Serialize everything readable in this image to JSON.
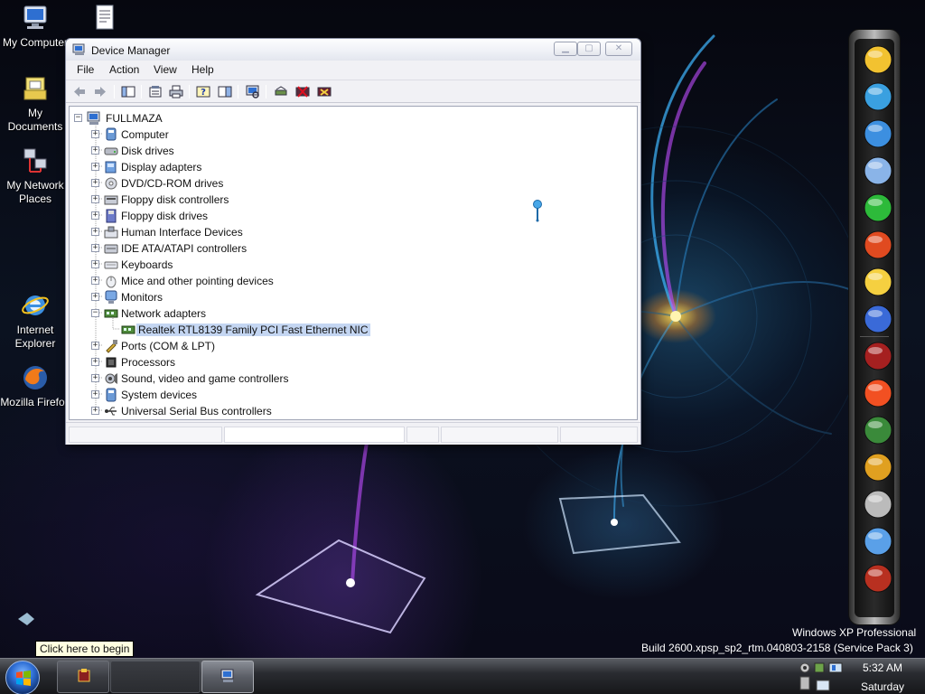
{
  "desktop": {
    "icons": [
      {
        "label": "My Computer"
      },
      {
        "label": "My Documents"
      },
      {
        "label": "My Network Places"
      },
      {
        "label": "Internet Explorer"
      },
      {
        "label": "Mozilla Firefox"
      }
    ],
    "os_name": "Windows XP Professional",
    "os_build": "Build 2600.xpsp_sp2_rtm.040803-2158 (Service Pack 3)",
    "tooltip": "Click here to begin"
  },
  "window": {
    "title": "Device Manager",
    "menu": [
      "File",
      "Action",
      "View",
      "Help"
    ],
    "toolbar_icons": [
      "back-icon",
      "forward-icon",
      "console-tree-icon",
      "properties-icon",
      "print-icon",
      "help-icon",
      "show-hide-icon",
      "scan-hardware-icon",
      "update-driver-icon",
      "disable-device-icon",
      "uninstall-device-icon"
    ],
    "tree": {
      "root": "FULLMAZA",
      "categories": [
        {
          "label": "Computer",
          "icon": "computer-icon",
          "expanded": false
        },
        {
          "label": "Disk drives",
          "icon": "disk-drive-icon",
          "expanded": false
        },
        {
          "label": "Display adapters",
          "icon": "display-adapter-icon",
          "expanded": false
        },
        {
          "label": "DVD/CD-ROM drives",
          "icon": "cd-drive-icon",
          "expanded": false
        },
        {
          "label": "Floppy disk controllers",
          "icon": "floppy-controller-icon",
          "expanded": false
        },
        {
          "label": "Floppy disk drives",
          "icon": "floppy-drive-icon",
          "expanded": false
        },
        {
          "label": "Human Interface Devices",
          "icon": "hid-icon",
          "expanded": false
        },
        {
          "label": "IDE ATA/ATAPI controllers",
          "icon": "ide-controller-icon",
          "expanded": false
        },
        {
          "label": "Keyboards",
          "icon": "keyboard-icon",
          "expanded": false
        },
        {
          "label": "Mice and other pointing devices",
          "icon": "mouse-icon",
          "expanded": false
        },
        {
          "label": "Monitors",
          "icon": "monitor-icon",
          "expanded": false
        },
        {
          "label": "Network adapters",
          "icon": "network-adapter-icon",
          "expanded": true,
          "children": [
            {
              "label": "Realtek RTL8139 Family PCI Fast Ethernet NIC",
              "icon": "network-card-icon",
              "selected": true
            }
          ]
        },
        {
          "label": "Ports (COM & LPT)",
          "icon": "port-icon",
          "expanded": false
        },
        {
          "label": "Processors",
          "icon": "processor-icon",
          "expanded": false
        },
        {
          "label": "Sound, video and game controllers",
          "icon": "sound-icon",
          "expanded": false
        },
        {
          "label": "System devices",
          "icon": "system-device-icon",
          "expanded": false
        },
        {
          "label": "Universal Serial Bus controllers",
          "icon": "usb-icon",
          "expanded": false
        }
      ]
    }
  },
  "dock": {
    "items": [
      "winamp-icon",
      "monitor-icon",
      "internet-explorer-icon",
      "media-player-icon",
      "green-e-icon",
      "media-player-classic-icon",
      "messenger-smiley-icon",
      "msn-messenger-icon",
      "video-clip-icon",
      "windows-flag-icon",
      "books-stack-icon",
      "paint-brushes-icon",
      "printer-icon",
      "network-tools-icon",
      "monster-icon"
    ]
  },
  "taskbar": {
    "time": "5:32 AM",
    "day": "Saturday",
    "buttons": [
      "winrar-task-icon",
      "device-manager-task-icon"
    ],
    "tray_icons": [
      "webcam-tray-icon",
      "network-tray-icon",
      "speaker-tray-icon",
      "tray-app-icon",
      "tray-app2-icon"
    ]
  },
  "colors": {
    "selection": "#c4d6f2",
    "window_bg": "#f1f1f5",
    "tooltip_bg": "#ffffe1"
  }
}
